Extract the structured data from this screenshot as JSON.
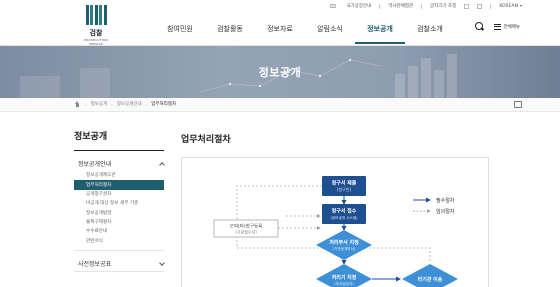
{
  "util": {
    "lang_label": "국가상징안내",
    "link2": "역사관체험관",
    "link3": "글자크기 조정",
    "lang_select": "KOREAN"
  },
  "logo": {
    "name": "검찰",
    "eng": "PROSECUTION SERVICE"
  },
  "gnb": [
    "참여민원",
    "검찰활동",
    "정보자료",
    "알림소식",
    "정보공개",
    "검찰소개"
  ],
  "gnb_active": "정보공개",
  "menu_label": "전체메뉴",
  "banner": {
    "title": "정보공개"
  },
  "breadcrumb": [
    "정보공개",
    "정보공개안내",
    "업무처리절차"
  ],
  "sidebar": {
    "title": "정보공개",
    "group1": "정보공개안내",
    "items": [
      "정보공개제도란",
      "업무처리절차",
      "공개청구권자",
      "비공개 대상 정보 세부 기준",
      "정보공개법령",
      "불복구제절차",
      "수수료안내",
      "관련서식"
    ],
    "active_item": "업무처리절차",
    "group2": "사전정보공표"
  },
  "content": {
    "title": "업무처리절차"
  },
  "diagram": {
    "boxes": [
      "청구서 제출",
      "(청구인)",
      "청구서 접수",
      "(정보공개 시스템)",
      "처리부서 지정",
      "(기관공개부서)",
      "처리기 지정",
      "(부서담당자)",
      "타기관 이송"
    ],
    "side_box": [
      "모의(타)청구등록",
      "(기관접수처)"
    ],
    "legend": [
      "필수절차",
      "임의절차"
    ]
  },
  "colors": {
    "accent": "#1f5e6e",
    "diamond": "#3d8fd6",
    "box": "#1e4f91"
  }
}
